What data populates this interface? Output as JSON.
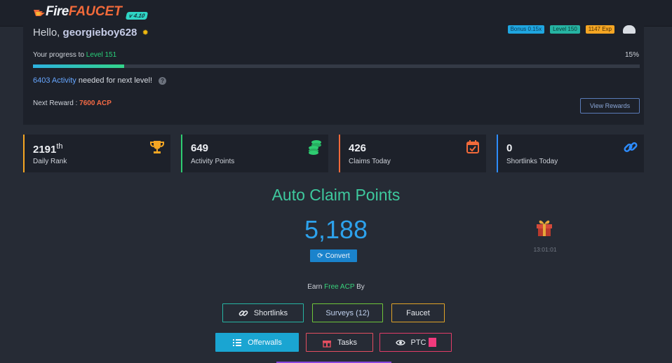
{
  "header": {
    "logo_fire": "Fire",
    "logo_faucet": "FAUCET",
    "version": "v 4.10"
  },
  "level_card": {
    "greeting": "Hello,",
    "username": "georgieboy628",
    "badges": {
      "bonus": "Bonus 0.15x",
      "level": "Level 150",
      "exp": "1147 Exp"
    },
    "progress_prefix": "Your progress to",
    "next_level": "Level 151",
    "progress_percent_label": "15%",
    "progress_fraction": 0.15,
    "activity_amount": "6403 Activity",
    "activity_suffix": "needed for next level!",
    "next_reward_label": "Next Reward :",
    "next_reward_value": "7600 ACP",
    "view_rewards": "View Rewards"
  },
  "stats": [
    {
      "value": "2191",
      "suffix": "th",
      "label": "Daily Rank",
      "icon": "trophy-icon",
      "color": "#f5a623"
    },
    {
      "value": "649",
      "suffix": "",
      "label": "Activity Points",
      "icon": "coins-icon",
      "color": "#2ecc71"
    },
    {
      "value": "426",
      "suffix": "",
      "label": "Claims Today",
      "icon": "calendar-check-icon",
      "color": "#f26a3a"
    },
    {
      "value": "0",
      "suffix": "",
      "label": "Shortlinks Today",
      "icon": "link-icon",
      "color": "#2d8cff"
    }
  ],
  "auto_claim": {
    "title": "Auto Claim Points",
    "value": "5,188",
    "convert": "Convert",
    "gift_timer": "13:01:01"
  },
  "earn": {
    "prefix": "Earn",
    "free": "Free ACP",
    "suffix": "By",
    "buttons": {
      "shortlinks": "Shortlinks",
      "surveys": "Surveys (12)",
      "faucet": "Faucet",
      "offerwalls": "Offerwalls",
      "tasks": "Tasks",
      "ptc": "PTC"
    }
  }
}
